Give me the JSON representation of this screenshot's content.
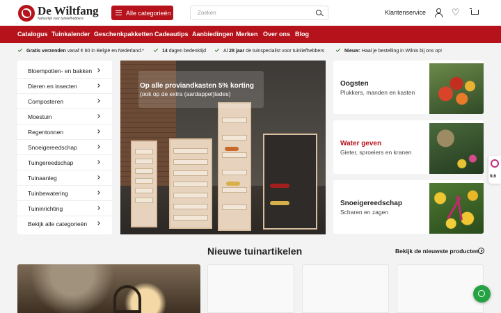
{
  "header": {
    "logo_name": "De Wiltfang",
    "logo_tagline": "Natuurlijk voor tuinliefhebbers",
    "categories_button": "Alle categorieën",
    "search_placeholder": "Zoeken",
    "customer_service": "Klantenservice",
    "icons": [
      "user-icon",
      "heart-icon",
      "cart-icon"
    ]
  },
  "nav": {
    "items": [
      "Catalogus",
      "Tuinkalender",
      "Geschenkpakketten",
      "Cadeautips",
      "Aanbiedingen",
      "Merken",
      "Over ons",
      "Blog"
    ]
  },
  "usps": [
    {
      "bold": "Gratis verzenden",
      "text": " vanaf € 60 in België en Nederland.*"
    },
    {
      "bold": "14",
      "text": " dagen bedenktijd"
    },
    {
      "prefix": "Al ",
      "bold": "28 jaar",
      "text": " de tuinspecialist voor tuinliefhebbers"
    },
    {
      "bold": "Nieuw:",
      "text": " Haal je bestelling in Wilnis bij ons op!"
    }
  ],
  "categories": [
    "Bloempotten- en bakken",
    "Dieren en insecten",
    "Composteren",
    "Moestuin",
    "Regentonnen",
    "Snoeigereedschap",
    "Tuingereedschap",
    "Tuinaanleg",
    "Tuinbewatering",
    "Tuininrichting",
    "Bekijk alle categorieën"
  ],
  "hero": {
    "title": "Op alle proviandkasten 5% korting",
    "subtitle": "(ook op de extra (aardappel)lades)"
  },
  "cards": [
    {
      "title": "Oogsten",
      "subtitle": "Plukkers, manden en kasten",
      "title_color": "#222222"
    },
    {
      "title": "Water geven",
      "subtitle": "Gieter, sproeiers en kranen",
      "title_color": "#b5121b"
    },
    {
      "title": "Snoeigereedschap",
      "subtitle": "Scharen en zagen",
      "title_color": "#222222"
    }
  ],
  "rating": {
    "score": "9,6"
  },
  "new_items": {
    "title": "Nieuwe tuinartikelen",
    "see_all": "Bekijk de nieuwste producten"
  },
  "colors": {
    "brand": "#b5121b",
    "whatsapp": "#25a244"
  }
}
